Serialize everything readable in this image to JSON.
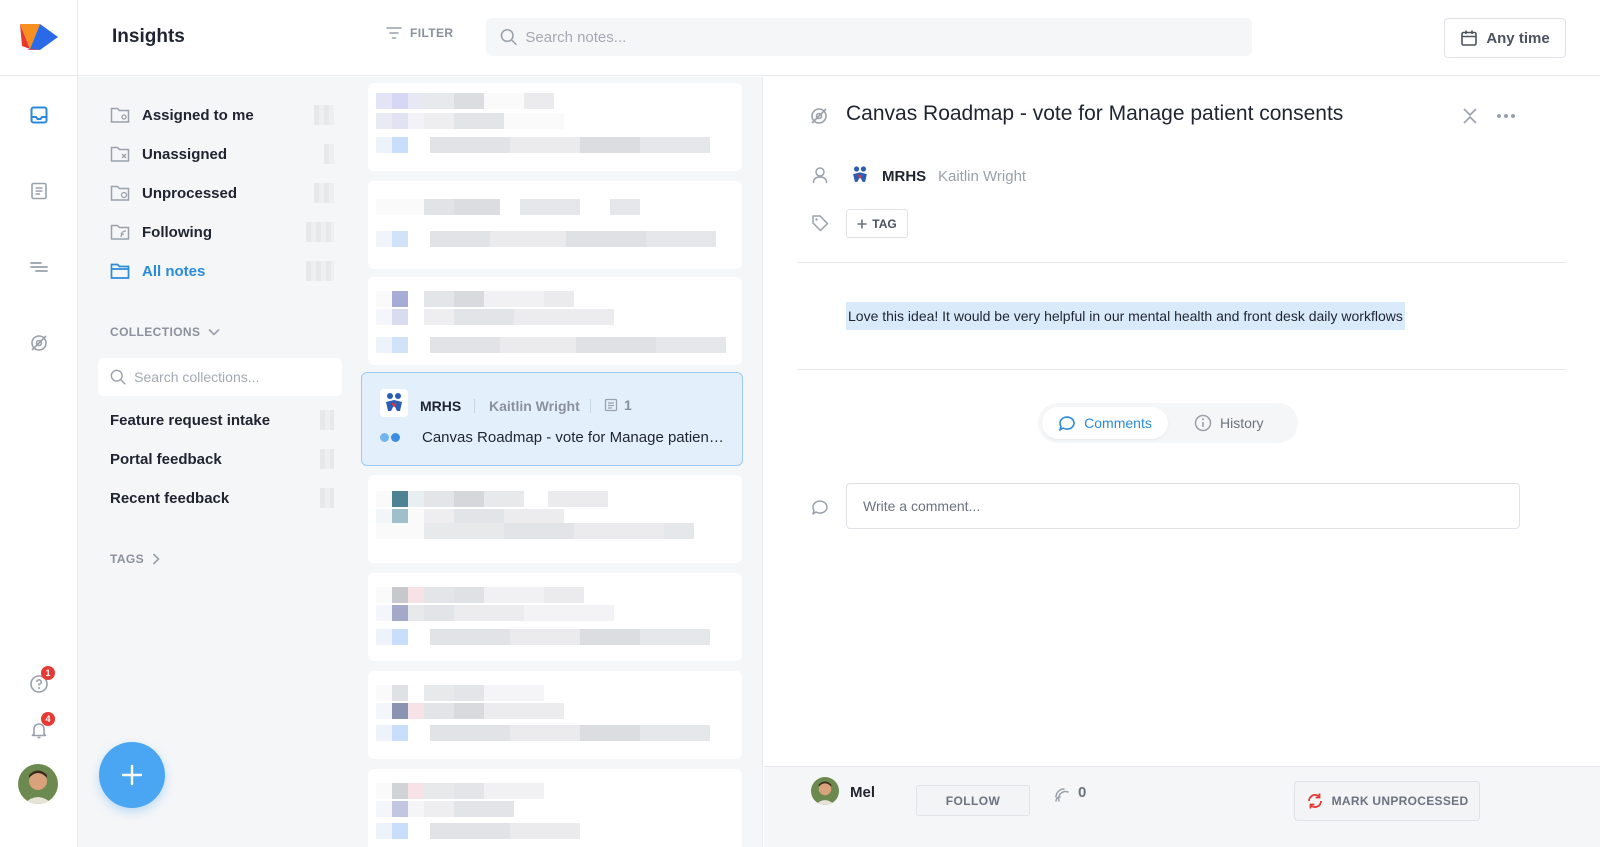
{
  "app": {
    "brand_colors": {
      "orange": "#F7901E",
      "blue": "#2A6AE8",
      "red": "#E8372C"
    }
  },
  "header": {
    "title": "Insights",
    "filter_label": "FILTER",
    "search_placeholder": "Search notes...",
    "date_filter_label": "Any time"
  },
  "rail": {
    "items": [
      {
        "name": "insights",
        "icon": "inbox-icon",
        "active": true
      },
      {
        "name": "notes",
        "icon": "document-icon"
      },
      {
        "name": "roadmap",
        "icon": "lines-icon"
      },
      {
        "name": "portal",
        "icon": "eye-slash-icon"
      }
    ],
    "help_badge": "1",
    "notifications_badge": "4"
  },
  "sidebar": {
    "nav": [
      {
        "label": "Assigned to me",
        "icon": "folder-user-icon"
      },
      {
        "label": "Unassigned",
        "icon": "folder-x-icon"
      },
      {
        "label": "Unprocessed",
        "icon": "folder-clock-icon"
      },
      {
        "label": "Following",
        "icon": "folder-follow-icon"
      },
      {
        "label": "All notes",
        "icon": "folder-icon",
        "active": true
      }
    ],
    "collections_title": "COLLECTIONS",
    "collections_search_placeholder": "Search collections...",
    "collections": [
      {
        "label": "Feature request intake"
      },
      {
        "label": "Portal feedback"
      },
      {
        "label": "Recent feedback"
      }
    ],
    "tags_title": "TAGS"
  },
  "notes_list": {
    "selected": {
      "org": "MRHS",
      "user": "Kaitlin Wright",
      "count": "1",
      "title": "Canvas Roadmap - vote for Manage patient consents"
    }
  },
  "detail": {
    "title": "Canvas Roadmap - vote for Manage patient consents",
    "org": "MRHS",
    "user": "Kaitlin Wright",
    "tag_button_label": "TAG",
    "body": "Love this idea! It would be very helpful in our mental health and front desk daily workflows",
    "tabs": [
      {
        "label": "Comments",
        "active": true
      },
      {
        "label": "History"
      }
    ],
    "comment_placeholder": "Write a comment..."
  },
  "footer": {
    "user": "Mel",
    "follow_label": "FOLLOW",
    "followers_count": "0",
    "mark_label": "MARK UNPROCESSED"
  }
}
